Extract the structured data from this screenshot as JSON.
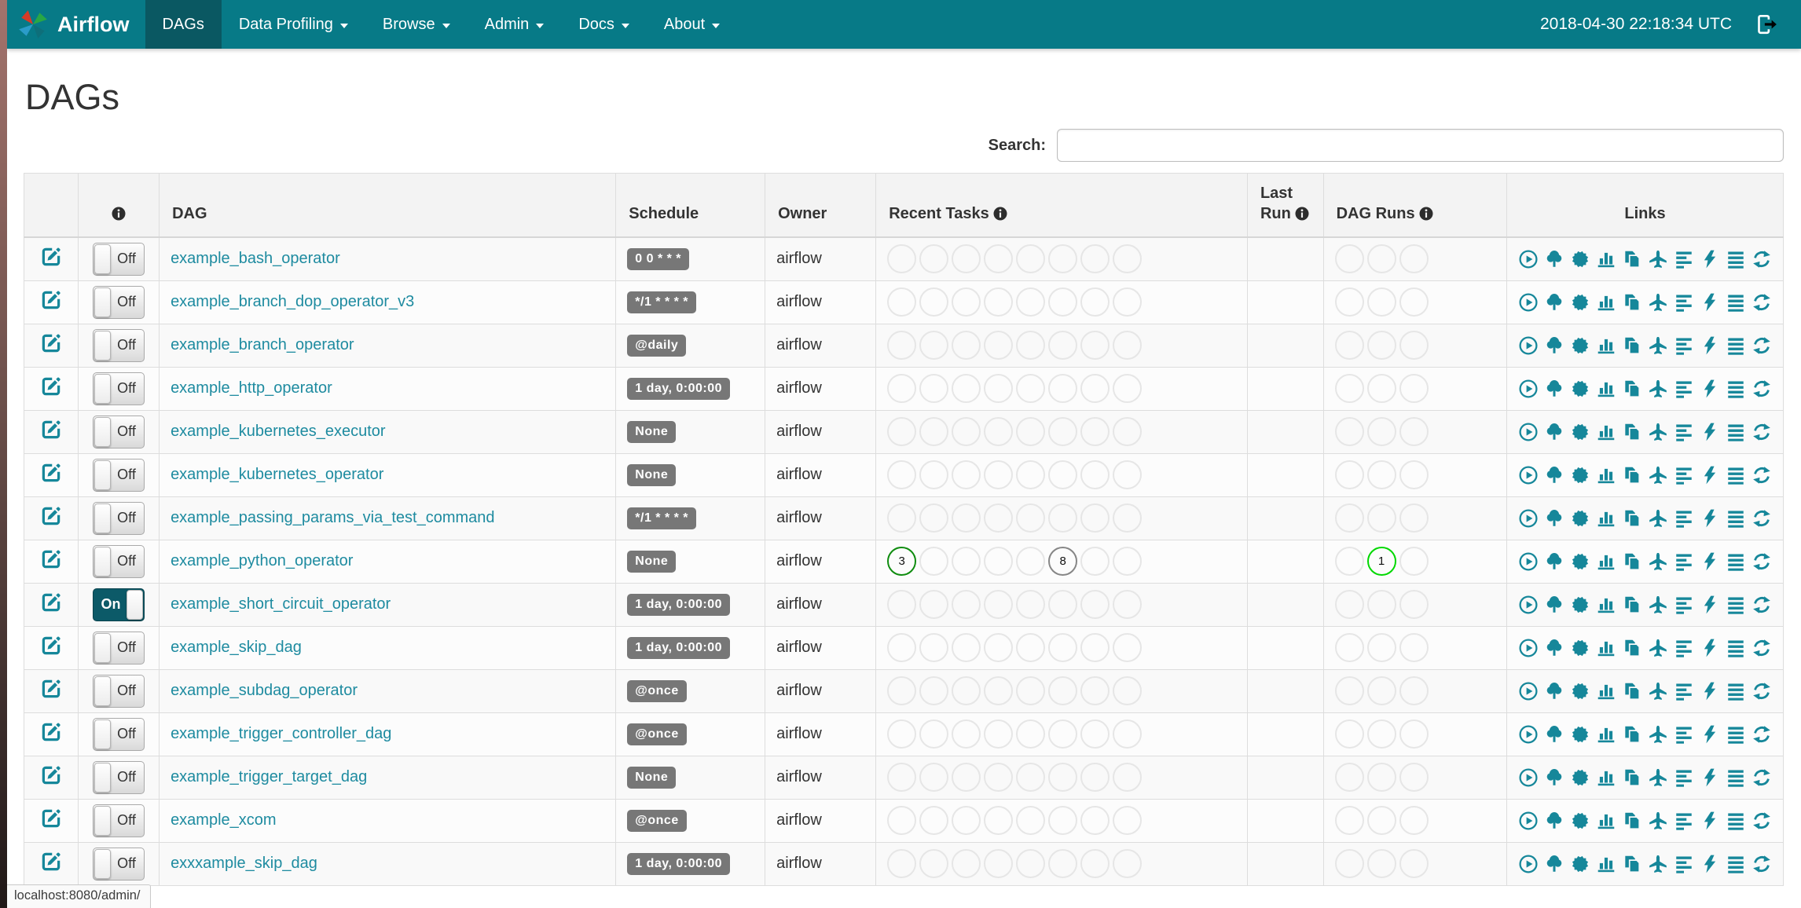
{
  "navbar": {
    "brand": "Airflow",
    "items": [
      {
        "label": "DAGs",
        "active": true,
        "caret": false
      },
      {
        "label": "Data Profiling",
        "active": false,
        "caret": true
      },
      {
        "label": "Browse",
        "active": false,
        "caret": true
      },
      {
        "label": "Admin",
        "active": false,
        "caret": true
      },
      {
        "label": "Docs",
        "active": false,
        "caret": true
      },
      {
        "label": "About",
        "active": false,
        "caret": true
      }
    ],
    "clock": "2018-04-30 22:18:34 UTC"
  },
  "page": {
    "title": "DAGs"
  },
  "search": {
    "label": "Search:",
    "value": "",
    "placeholder": ""
  },
  "table": {
    "headers": {
      "edit": "",
      "info": "",
      "dag": "DAG",
      "schedule": "Schedule",
      "owner": "Owner",
      "recent_tasks": "Recent Tasks",
      "last_run_line1": "Last",
      "last_run_line2": "Run",
      "dag_runs": "DAG Runs",
      "links": "Links"
    },
    "toggle": {
      "on": "On",
      "off": "Off"
    },
    "recent_task_slots": 8,
    "dag_run_slots": 3,
    "rows": [
      {
        "dag": "example_bash_operator",
        "enabled": false,
        "schedule": "0 0 * * *",
        "owner": "airflow",
        "last_run": "",
        "recent_tasks": [],
        "dag_runs": []
      },
      {
        "dag": "example_branch_dop_operator_v3",
        "enabled": false,
        "schedule": "*/1 * * * *",
        "owner": "airflow",
        "last_run": "",
        "recent_tasks": [],
        "dag_runs": []
      },
      {
        "dag": "example_branch_operator",
        "enabled": false,
        "schedule": "@daily",
        "owner": "airflow",
        "last_run": "",
        "recent_tasks": [],
        "dag_runs": []
      },
      {
        "dag": "example_http_operator",
        "enabled": false,
        "schedule": "1 day, 0:00:00",
        "owner": "airflow",
        "last_run": "",
        "recent_tasks": [],
        "dag_runs": []
      },
      {
        "dag": "example_kubernetes_executor",
        "enabled": false,
        "schedule": "None",
        "owner": "airflow",
        "last_run": "",
        "recent_tasks": [],
        "dag_runs": []
      },
      {
        "dag": "example_kubernetes_operator",
        "enabled": false,
        "schedule": "None",
        "owner": "airflow",
        "last_run": "",
        "recent_tasks": [],
        "dag_runs": []
      },
      {
        "dag": "example_passing_params_via_test_command",
        "enabled": false,
        "schedule": "*/1 * * * *",
        "owner": "airflow",
        "last_run": "",
        "recent_tasks": [],
        "dag_runs": []
      },
      {
        "dag": "example_python_operator",
        "enabled": false,
        "schedule": "None",
        "owner": "airflow",
        "last_run": "",
        "recent_tasks": [
          {
            "index": 0,
            "value": "3",
            "state": "success"
          },
          {
            "index": 5,
            "value": "8",
            "state": "none"
          }
        ],
        "dag_runs": [
          {
            "index": 1,
            "value": "1",
            "state": "running"
          }
        ]
      },
      {
        "dag": "example_short_circuit_operator",
        "enabled": true,
        "schedule": "1 day, 0:00:00",
        "owner": "airflow",
        "last_run": "",
        "recent_tasks": [],
        "dag_runs": []
      },
      {
        "dag": "example_skip_dag",
        "enabled": false,
        "schedule": "1 day, 0:00:00",
        "owner": "airflow",
        "last_run": "",
        "recent_tasks": [],
        "dag_runs": []
      },
      {
        "dag": "example_subdag_operator",
        "enabled": false,
        "schedule": "@once",
        "owner": "airflow",
        "last_run": "",
        "recent_tasks": [],
        "dag_runs": []
      },
      {
        "dag": "example_trigger_controller_dag",
        "enabled": false,
        "schedule": "@once",
        "owner": "airflow",
        "last_run": "",
        "recent_tasks": [],
        "dag_runs": []
      },
      {
        "dag": "example_trigger_target_dag",
        "enabled": false,
        "schedule": "None",
        "owner": "airflow",
        "last_run": "",
        "recent_tasks": [],
        "dag_runs": []
      },
      {
        "dag": "example_xcom",
        "enabled": false,
        "schedule": "@once",
        "owner": "airflow",
        "last_run": "",
        "recent_tasks": [],
        "dag_runs": []
      },
      {
        "dag": "exxxample_skip_dag",
        "enabled": false,
        "schedule": "1 day, 0:00:00",
        "owner": "airflow",
        "last_run": "",
        "recent_tasks": [],
        "dag_runs": []
      }
    ]
  },
  "links": [
    {
      "icon": "play-circle-icon",
      "label": "Trigger Dag"
    },
    {
      "icon": "tree-icon",
      "label": "Tree View"
    },
    {
      "icon": "sunburst-icon",
      "label": "Graph View"
    },
    {
      "icon": "bar-chart-icon",
      "label": "Task Duration"
    },
    {
      "icon": "duplicate-icon",
      "label": "Task Tries"
    },
    {
      "icon": "plane-icon",
      "label": "Landing Times"
    },
    {
      "icon": "align-left-icon",
      "label": "Gantt View"
    },
    {
      "icon": "flash-icon",
      "label": "Code View"
    },
    {
      "icon": "align-justify-icon",
      "label": "Logs"
    },
    {
      "icon": "refresh-icon",
      "label": "Refresh"
    }
  ],
  "status_bar": {
    "url": "localhost:8080/admin/"
  },
  "colors": {
    "navbar": "#077a87",
    "navbar_active": "#0a5862",
    "link": "#1e8ba0",
    "icon": "#16879a",
    "badge": "#777777",
    "states": {
      "success": "#0f8c0f",
      "none": "#868686",
      "running": "#00d800"
    }
  }
}
